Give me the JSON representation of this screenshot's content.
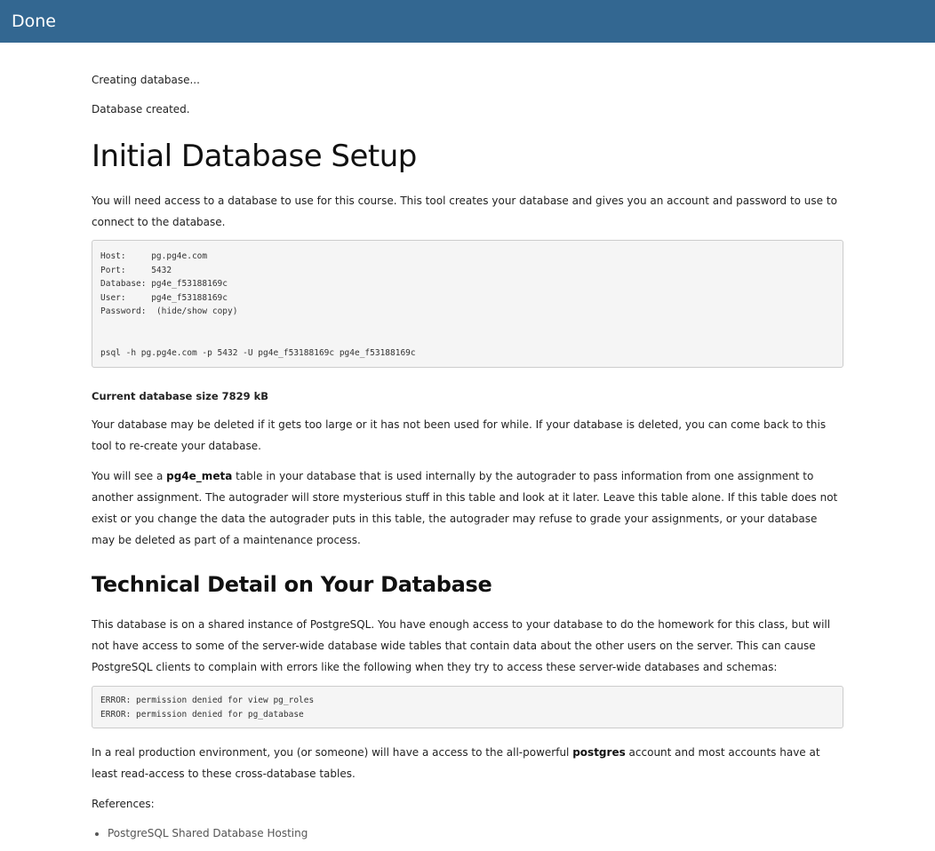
{
  "header": {
    "title": "Done"
  },
  "status": {
    "creating": "Creating database...",
    "created": "Database created."
  },
  "setup": {
    "title": "Initial Database Setup",
    "intro": "You will need access to a database to use for this course. This tool creates your database and gives you an account and password to use to connect to the database.",
    "connection": {
      "host_label": "Host:     ",
      "host": "pg.pg4e.com",
      "port_label": "Port:     ",
      "port": "5432",
      "database_label": "Database: ",
      "database": "pg4e_f53188169c",
      "user_label": "User:     ",
      "user": "pg4e_f53188169c",
      "password_label": "Password: ",
      "password_link": "(hide/show copy)",
      "psql_command": "psql -h pg.pg4e.com -p 5432 -U pg4e_f53188169c pg4e_f53188169c"
    },
    "size_text": "Current database size 7829 kB",
    "deleted_para": "Your database may be deleted if it gets too large or it has not been used for while. If your database is deleted, you can come back to this tool to re-create your database.",
    "meta_para": {
      "before": "You will see a ",
      "bold": "pg4e_meta",
      "after": " table in your database that is used internally by the autograder to pass information from one assignment to another assignment. The autograder will store mysterious stuff in this table and look at it later. Leave this table alone. If this table does not exist or you change the data the autograder puts in this table, the autograder may refuse to grade your assignments, or your database may be deleted as part of a maintenance process."
    }
  },
  "technical": {
    "title": "Technical Detail on Your Database",
    "para": "This database is on a shared instance of PostgreSQL. You have enough access to your database to do the homework for this class, but will not have access to some of the server-wide database wide tables that contain data about the other users on the server. This can cause PostgreSQL clients to complain with errors like the following when they try to access these server-wide databases and schemas:",
    "errors": [
      "ERROR: permission denied for view pg_roles",
      "ERROR: permission denied for pg_database"
    ],
    "prod_para": {
      "before": "In a real production environment, you (or someone) will have a access to the all-powerful ",
      "bold": "postgres",
      "after": " account and most accounts have at least read-access to these cross-database tables."
    },
    "references_label": "References:",
    "references": [
      "PostgreSQL Shared Database Hosting"
    ]
  }
}
